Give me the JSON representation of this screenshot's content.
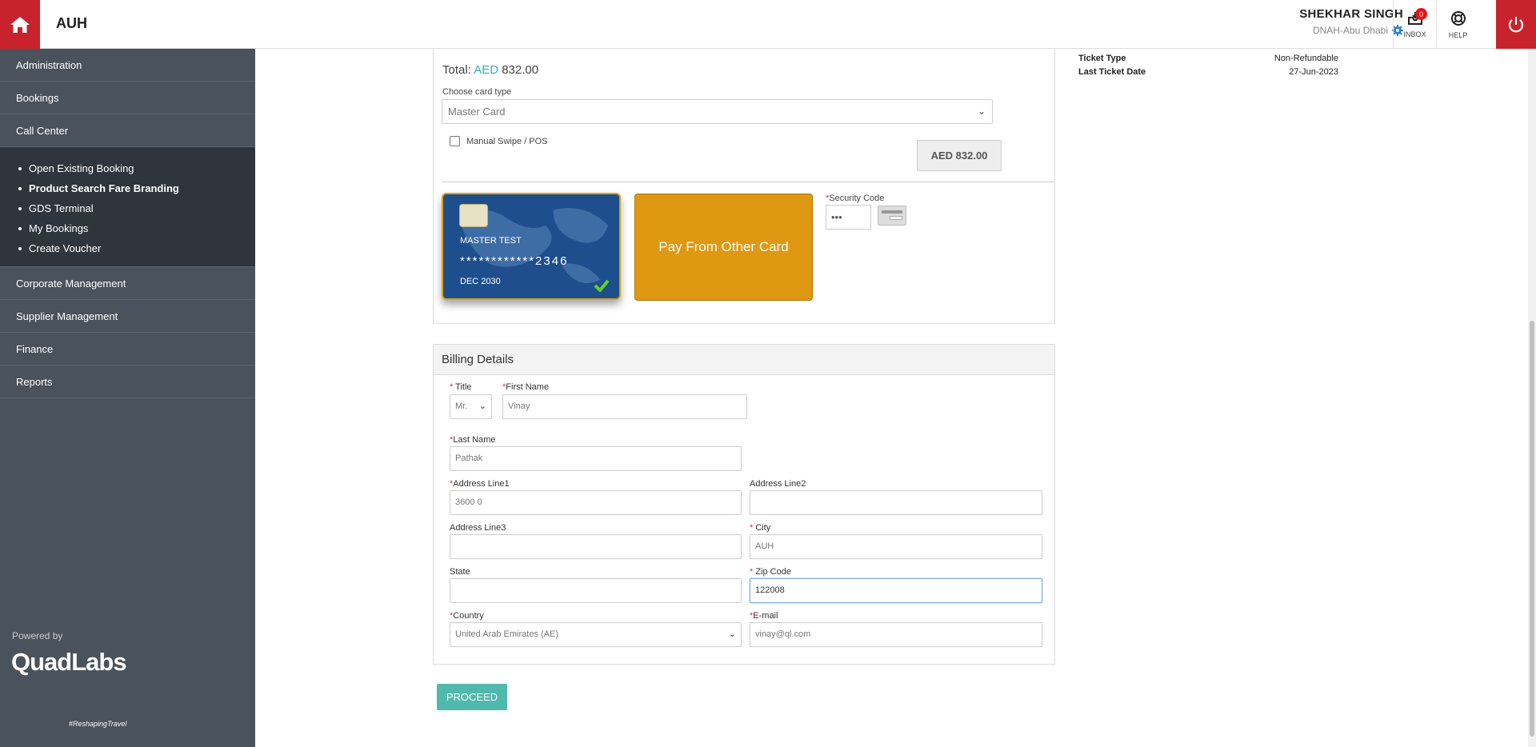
{
  "header": {
    "brand": "AUH",
    "user_name": "SHEKHAR SINGH",
    "user_office": "DNAH-Abu Dhabi",
    "inbox_label": "INBOX",
    "inbox_count": "0",
    "help_label": "HELP",
    "accent_color": "#c8232c"
  },
  "sidebar": {
    "items_top": [
      {
        "label": "Administration"
      },
      {
        "label": "Bookings"
      },
      {
        "label": "Call Center"
      }
    ],
    "sub_items": [
      {
        "label": "Open Existing Booking"
      },
      {
        "label": "Product Search Fare Branding"
      },
      {
        "label": "GDS Terminal"
      },
      {
        "label": "My Bookings"
      },
      {
        "label": "Create Voucher"
      }
    ],
    "items_bottom": [
      {
        "label": "Corporate Management"
      },
      {
        "label": "Supplier Management"
      },
      {
        "label": "Finance"
      },
      {
        "label": "Reports"
      }
    ],
    "powered_by": "Powered by",
    "logo_text": "QuadLabs",
    "logo_tagline": "#ReshapingTravel"
  },
  "payment": {
    "total_label": "Total:",
    "total_currency": "AED",
    "total_amount": "832.00",
    "card_type_label": "Choose card type",
    "card_type_value": "Master Card",
    "manual_swipe_label": "Manual Swipe / POS",
    "amount_button": "AED 832.00",
    "saved_card": {
      "holder": "MASTER TEST",
      "number": "************2346",
      "expiry": "DEC 2030"
    },
    "other_card_button": "Pay From Other Card",
    "security_code_label": "Security Code",
    "security_code_value": "•••"
  },
  "summary": {
    "rows": [
      {
        "key": "Ticket Type",
        "value": "Non-Refundable"
      },
      {
        "key": "Last Ticket Date",
        "value": "27-Jun-2023"
      }
    ]
  },
  "billing": {
    "heading": "Billing Details",
    "title_label": "Title",
    "title_value": "Mr.",
    "first_name_label": "First Name",
    "first_name_value": "Vinay",
    "last_name_label": "Last Name",
    "last_name_value": "Pathak",
    "address1_label": "Address Line1",
    "address1_value": "3600 0",
    "address2_label": "Address Line2",
    "address2_value": "",
    "address3_label": "Address Line3",
    "address3_value": "",
    "city_label": "City",
    "city_value": "AUH",
    "state_label": "State",
    "state_value": "",
    "zip_label": "Zip Code",
    "zip_value": "122008",
    "country_label": "Country",
    "country_value": "United Arab Emirates (AE)",
    "email_label": "E-mail",
    "email_value": "vinay@ql.com"
  },
  "proceed_button": "PROCEED"
}
